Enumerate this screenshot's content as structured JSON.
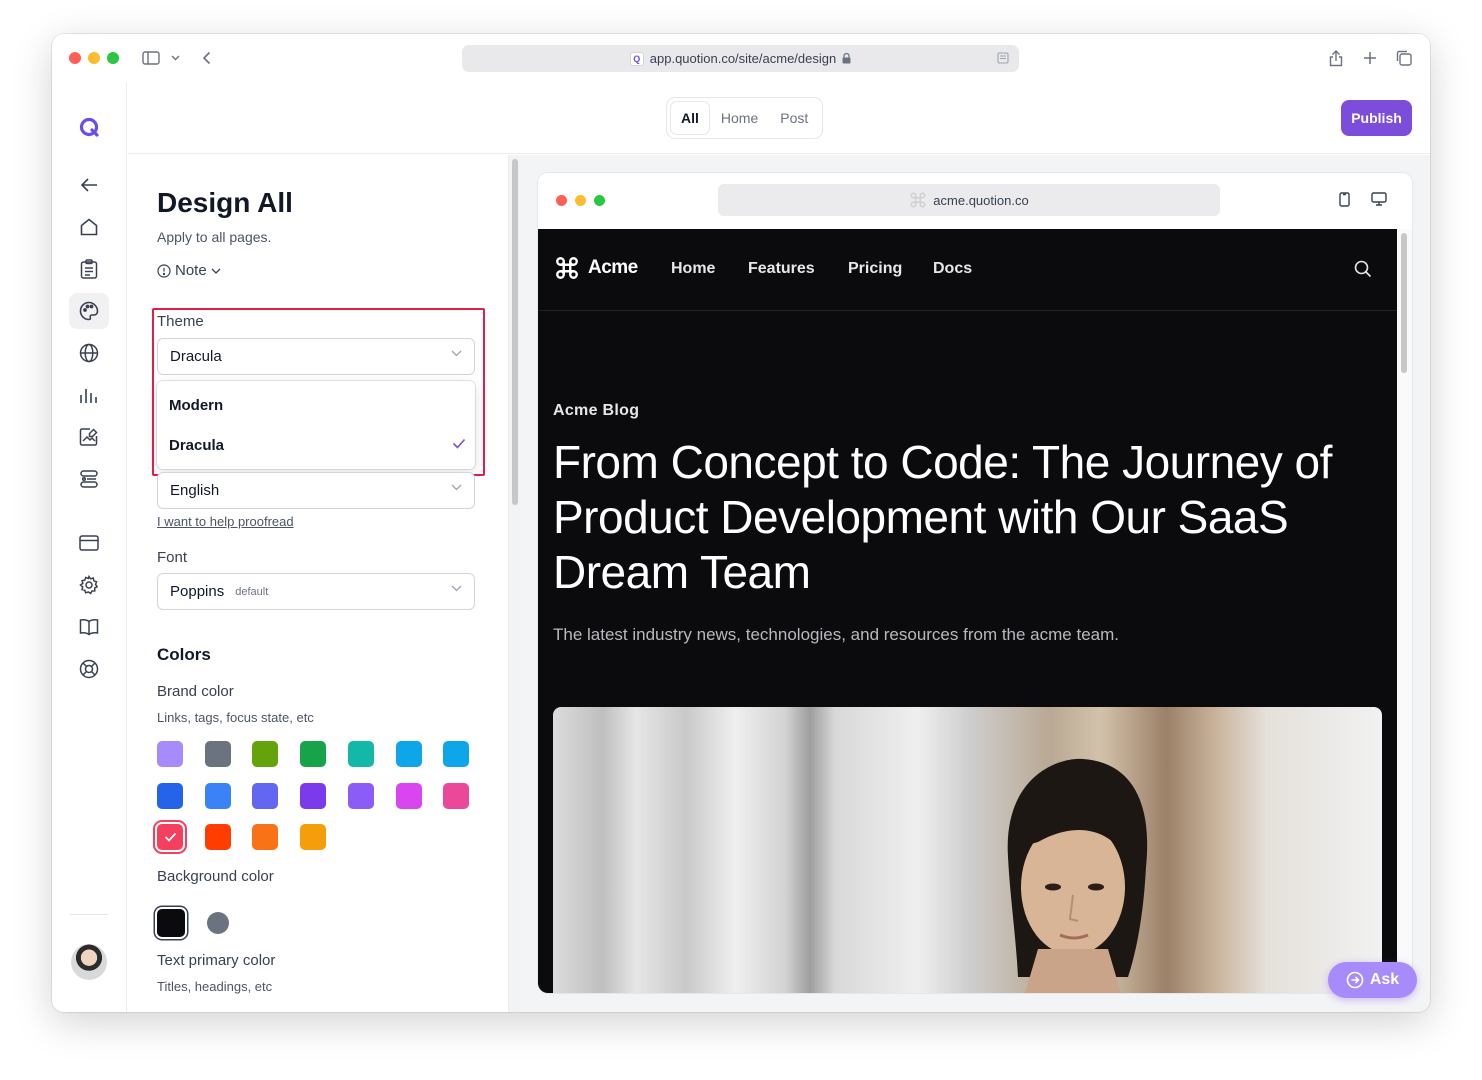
{
  "browser": {
    "url": "app.quotion.co/site/acme/design"
  },
  "topbar": {
    "tabs": [
      {
        "label": "All"
      },
      {
        "label": "Home"
      },
      {
        "label": "Post"
      }
    ],
    "publish_label": "Publish"
  },
  "panel": {
    "title": "Design All",
    "subtitle": "Apply to all pages.",
    "note_label": "Note",
    "theme": {
      "label": "Theme",
      "value": "Dracula",
      "options": [
        "Modern",
        "Dracula"
      ]
    },
    "language": {
      "value": "English",
      "proofread_link": "I want to help proofread"
    },
    "font": {
      "label": "Font",
      "value": "Poppins",
      "tag": "default"
    },
    "colors": {
      "section_title": "Colors",
      "brand": {
        "label": "Brand color",
        "sub": "Links, tags, focus state, etc",
        "swatches": [
          "#a78bfa",
          "#6b7280",
          "#65a30d",
          "#16a34a",
          "#14b8a6",
          "#0ea5e9",
          "#0ea5e9",
          "#2563eb",
          "#3b82f6",
          "#6366f1",
          "#7c3aed",
          "#8b5cf6",
          "#d946ef",
          "#ec4899",
          "#f43f5e",
          "#ff3d00",
          "#f97316",
          "#f59e0b"
        ],
        "selected": "#f43f5e"
      },
      "background": {
        "label": "Background color",
        "swatches": [
          "#0b0b0d",
          "#6b7280"
        ]
      },
      "text_primary": {
        "label": "Text primary color",
        "sub": "Titles, headings, etc"
      }
    }
  },
  "preview": {
    "url": "acme.quotion.co",
    "site": {
      "brand": "Acme",
      "nav": [
        "Home",
        "Features",
        "Pricing",
        "Docs"
      ],
      "kicker": "Acme Blog",
      "title": "From Concept to Code: The Journey of Product Development with Our SaaS Dream Team",
      "description": "The latest industry news, technologies, and resources from the acme team."
    }
  },
  "ask_label": "Ask",
  "colors": {
    "accent": "#7c4ddb",
    "highlight_border": "#e11d48"
  }
}
